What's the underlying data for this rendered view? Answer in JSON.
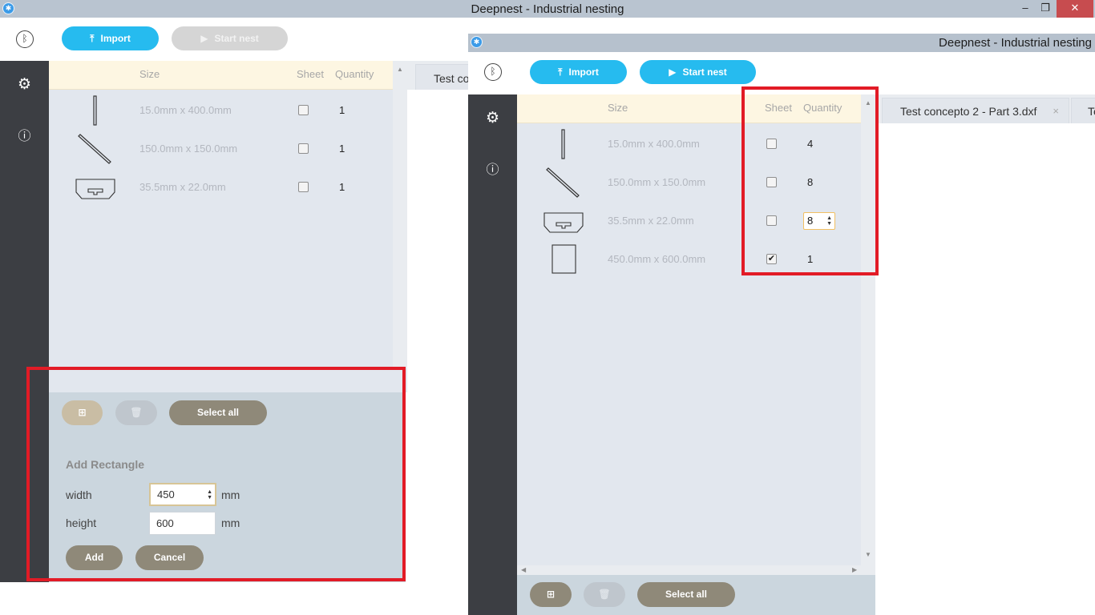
{
  "left_window": {
    "title": "Deepnest - Industrial nesting",
    "window_controls": {
      "minimize": "‒",
      "maximize": "❐",
      "close": "✕"
    },
    "toolbar": {
      "import_label": "Import",
      "start_nest_label": "Start nest"
    },
    "table": {
      "headers": {
        "size": "Size",
        "sheet": "Sheet",
        "quantity": "Quantity"
      },
      "rows": [
        {
          "size": "15.0mm x 400.0mm",
          "sheet": false,
          "quantity": "1",
          "icon": "vertical-bar-part-icon"
        },
        {
          "size": "150.0mm x 150.0mm",
          "sheet": false,
          "quantity": "1",
          "icon": "diagonal-part-icon"
        },
        {
          "size": "35.5mm x 22.0mm",
          "sheet": false,
          "quantity": "1",
          "icon": "bracket-part-icon"
        }
      ]
    },
    "tab_label": "Test co",
    "actions": {
      "select_all_label": "Select all"
    },
    "add_rectangle": {
      "heading": "Add Rectangle",
      "width_label": "width",
      "width_value": "450",
      "height_label": "height",
      "height_value": "600",
      "unit": "mm",
      "add_label": "Add",
      "cancel_label": "Cancel"
    }
  },
  "right_window": {
    "title": "Deepnest - Industrial nesting",
    "toolbar": {
      "import_label": "Import",
      "start_nest_label": "Start nest"
    },
    "table": {
      "headers": {
        "size": "Size",
        "sheet": "Sheet",
        "quantity": "Quantity"
      },
      "rows": [
        {
          "size": "15.0mm x 400.0mm",
          "sheet": false,
          "quantity": "4",
          "icon": "vertical-bar-part-icon"
        },
        {
          "size": "150.0mm x 150.0mm",
          "sheet": false,
          "quantity": "8",
          "icon": "diagonal-part-icon"
        },
        {
          "size": "35.5mm x 22.0mm",
          "sheet": false,
          "quantity": "8",
          "editing": true,
          "icon": "bracket-part-icon"
        },
        {
          "size": "450.0mm x 600.0mm",
          "sheet": true,
          "quantity": "1",
          "icon": "rectangle-part-icon"
        }
      ]
    },
    "tabs": [
      {
        "label": "Test concepto 2 - Part 3.dxf"
      },
      {
        "label": "Te"
      }
    ],
    "actions": {
      "select_all_label": "Select all"
    }
  },
  "colors": {
    "accent_blue": "#26bbef",
    "sidebar": "#3c3e43",
    "highlight_red": "#e21b26",
    "button_tan": "#8f8979"
  }
}
